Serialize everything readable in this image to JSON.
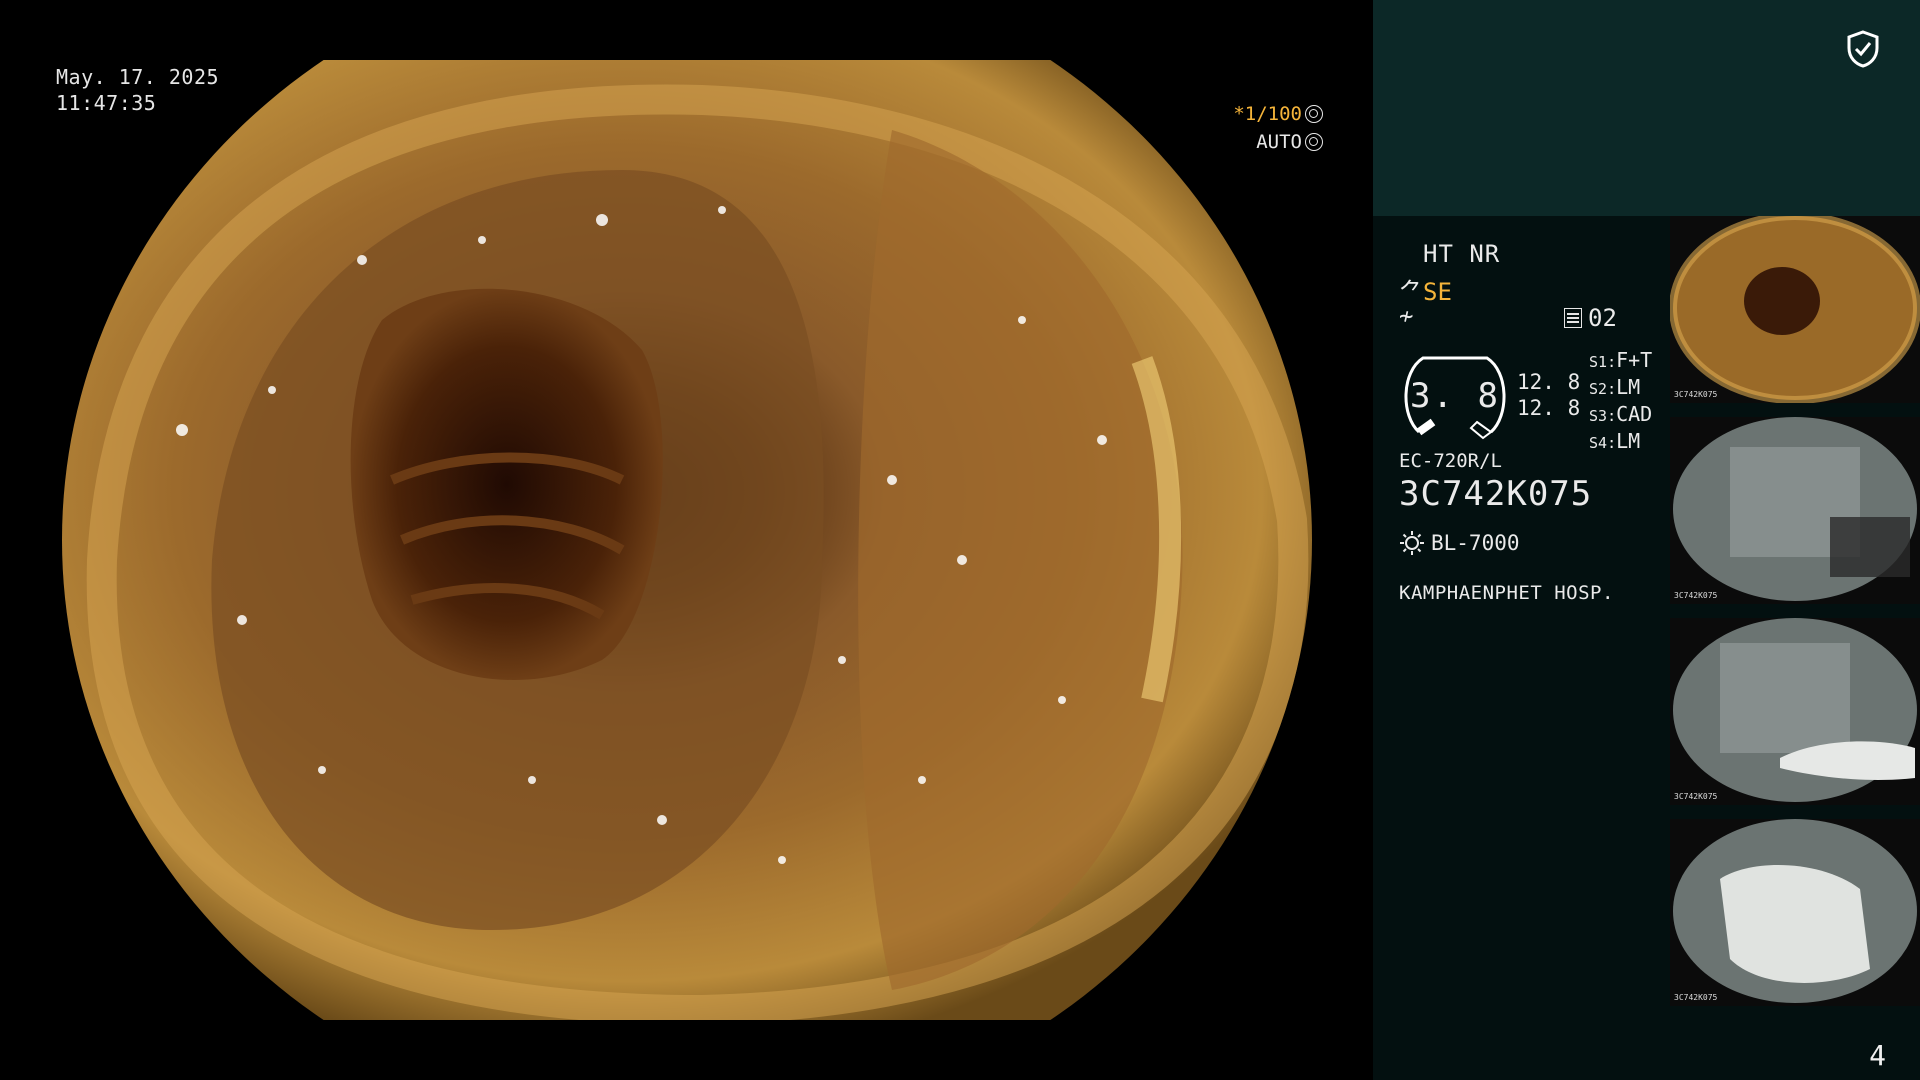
{
  "main": {
    "date": "May. 17. 2025",
    "time": "11:47:35",
    "shutter": "*1/100",
    "iris": "AUTO"
  },
  "panel": {
    "ht_nr": "HT NR",
    "se_prefix": "",
    "se_label": "SE",
    "memory": "02",
    "gauge_value": "3. 8",
    "zoom_a": "12. 8",
    "zoom_b": "12. 8",
    "switches": [
      {
        "key": "S1",
        "value": "F+T"
      },
      {
        "key": "S2",
        "value": "LM"
      },
      {
        "key": "S3",
        "value": "CAD"
      },
      {
        "key": "S4",
        "value": "LM"
      }
    ],
    "scope_model": "EC-720R/L",
    "scope_serial": "3C742K075",
    "light_source": "BL-7000",
    "hospital": "KAMPHAENPHET HOSP.",
    "page_number": "4",
    "thumbnail_caption": "3C742K075"
  },
  "colors": {
    "accent": "#f5b43a",
    "panel_top": "#0c2827",
    "panel_bg": "#031010"
  },
  "icons": [
    "shield-check-icon",
    "shutter-icon",
    "iris-icon",
    "memory-icon",
    "sun-icon"
  ]
}
